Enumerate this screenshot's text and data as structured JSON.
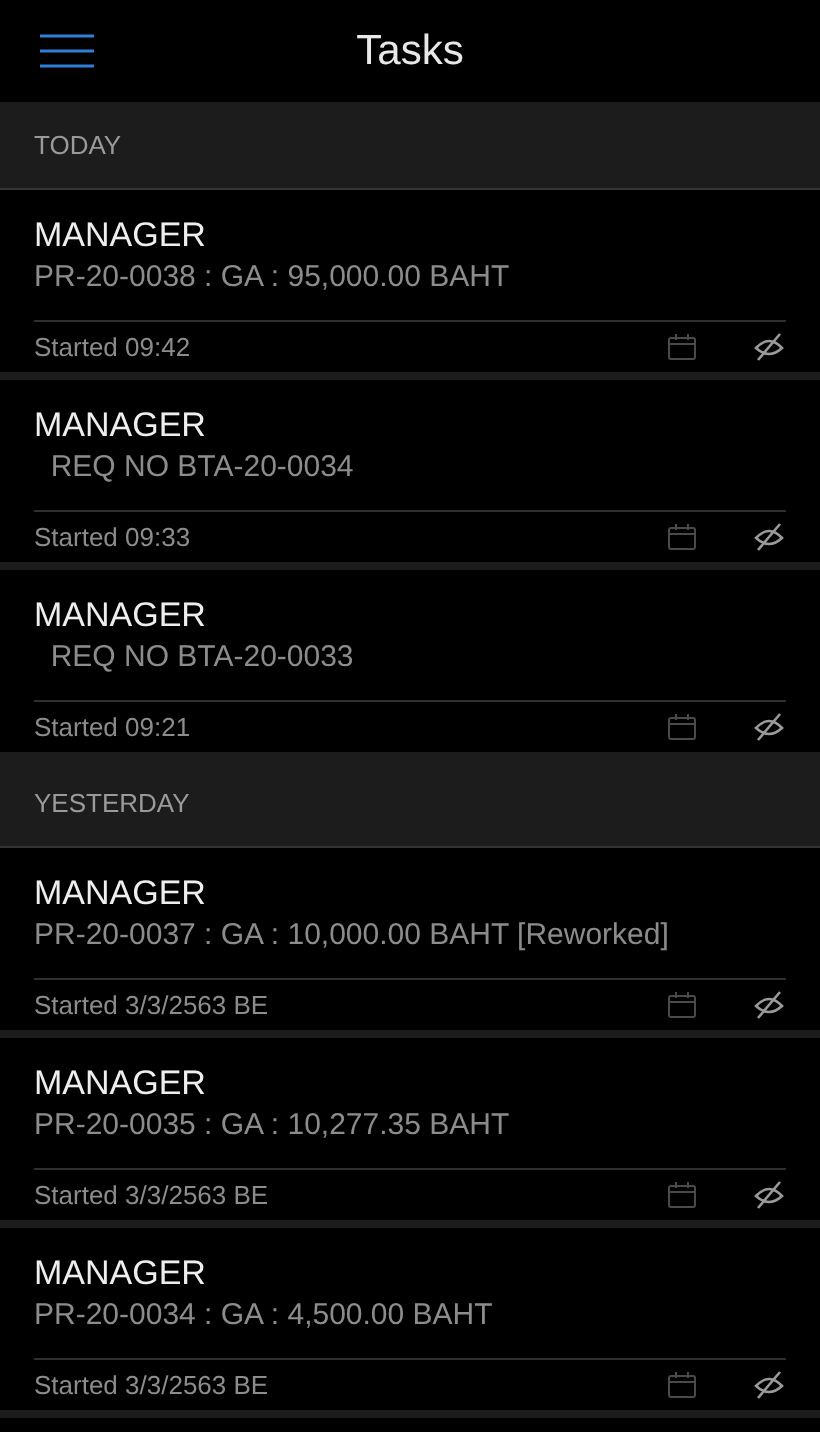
{
  "header": {
    "title": "Tasks"
  },
  "sections": [
    {
      "label": "TODAY",
      "tasks": [
        {
          "title": "MANAGER",
          "subtitle": "PR-20-0038 : GA : 95,000.00 BAHT",
          "started": "Started 09:42"
        },
        {
          "title": "MANAGER",
          "subtitle": "  REQ NO BTA-20-0034",
          "started": "Started 09:33"
        },
        {
          "title": "MANAGER",
          "subtitle": "  REQ NO BTA-20-0033",
          "started": "Started 09:21"
        }
      ]
    },
    {
      "label": "YESTERDAY",
      "tasks": [
        {
          "title": "MANAGER",
          "subtitle": "PR-20-0037 : GA : 10,000.00 BAHT [Reworked]",
          "started": "Started 3/3/2563 BE"
        },
        {
          "title": "MANAGER",
          "subtitle": "PR-20-0035 : GA : 10,277.35 BAHT",
          "started": "Started 3/3/2563 BE"
        },
        {
          "title": "MANAGER",
          "subtitle": "PR-20-0034 : GA : 4,500.00 BAHT",
          "started": "Started 3/3/2563 BE"
        }
      ]
    }
  ]
}
